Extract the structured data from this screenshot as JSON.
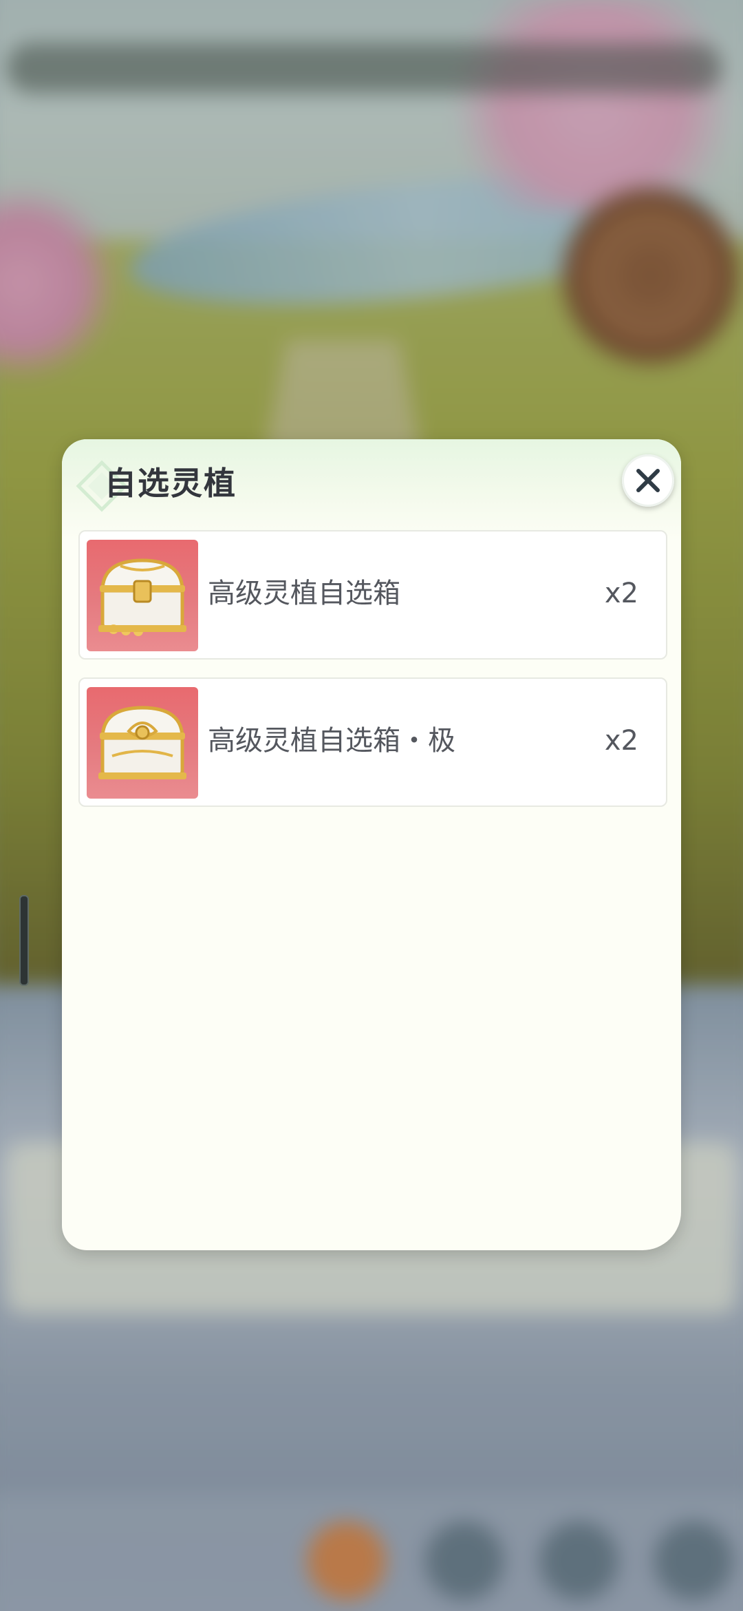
{
  "dialog": {
    "title": "自选灵植",
    "close_icon": "close-icon"
  },
  "items": [
    {
      "name": "高级灵植自选箱",
      "quantity": "x2",
      "icon": "treasure-chest-icon"
    },
    {
      "name": "高级灵植自选箱・极",
      "quantity": "x2",
      "icon": "treasure-chest-icon"
    }
  ],
  "colors": {
    "dialog_bg": "#fdfef6",
    "thumb_bg": "#e86a6f",
    "text": "#54575e",
    "title": "#33363d"
  }
}
